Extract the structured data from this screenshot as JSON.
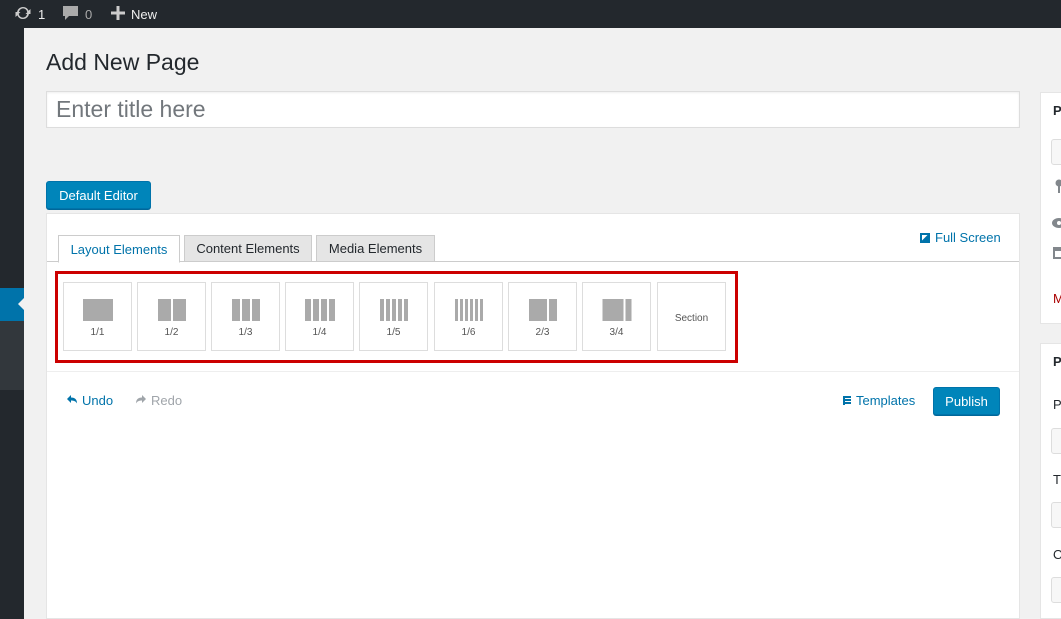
{
  "adminbar": {
    "updates_count": "1",
    "comments_count": "0",
    "new_label": "New"
  },
  "page": {
    "title": "Add New Page",
    "title_placeholder": "Enter title here"
  },
  "editor": {
    "default_editor_label": "Default Editor",
    "fullscreen_label": "Full Screen",
    "tabs": [
      {
        "label": "Layout Elements",
        "active": true
      },
      {
        "label": "Content Elements",
        "active": false
      },
      {
        "label": "Media Elements",
        "active": false
      }
    ],
    "layout_elements": [
      {
        "label": "1/1",
        "columns": 1
      },
      {
        "label": "1/2",
        "columns": 2
      },
      {
        "label": "1/3",
        "columns": 3
      },
      {
        "label": "1/4",
        "columns": 4
      },
      {
        "label": "1/5",
        "columns": 5
      },
      {
        "label": "1/6",
        "columns": 6
      },
      {
        "label": "2/3",
        "columns": 2
      },
      {
        "label": "3/4",
        "columns": 2
      },
      {
        "label": "Section",
        "columns": 0
      }
    ],
    "undo_label": "Undo",
    "redo_label": "Redo",
    "templates_label": "Templates",
    "publish_label": "Publish"
  },
  "right_panels": {
    "panel1_title_initial": "P",
    "panel1_link_initial": "M",
    "panel2_title_initial": "P",
    "panel2_field1_initial": "P",
    "panel2_field2_initial": "T",
    "panel2_field3_initial": "O"
  },
  "colors": {
    "accent": "#0085ba",
    "highlight": "#cc0000",
    "adminbar": "#23282d"
  }
}
